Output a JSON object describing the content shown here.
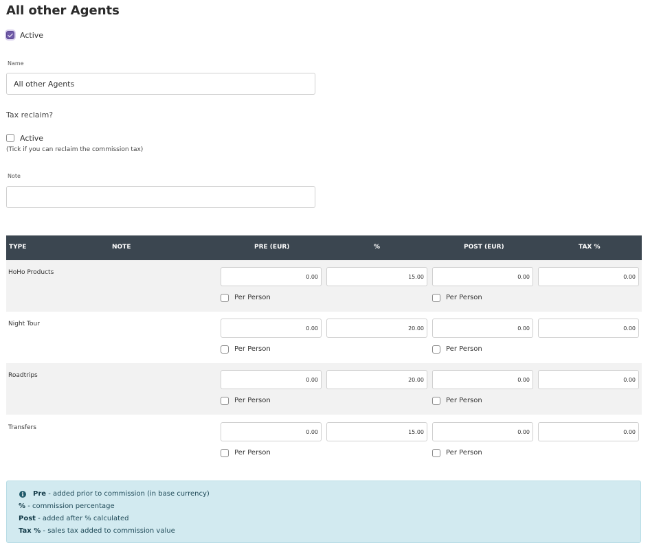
{
  "page_title": "All other Agents",
  "active_checkbox": {
    "label": "Active",
    "checked": true
  },
  "name_field": {
    "label": "Name",
    "value": "All other Agents"
  },
  "tax_reclaim": {
    "heading": "Tax reclaim?",
    "checkbox_label": "Active",
    "checked": false,
    "help": "(Tick if you can reclaim the commission tax)"
  },
  "note_field": {
    "label": "Note",
    "value": ""
  },
  "table": {
    "headers": {
      "type": "TYPE",
      "note": "NOTE",
      "pre": "PRE (EUR)",
      "pct": "%",
      "post": "POST (EUR)",
      "tax": "TAX %"
    },
    "per_person_label": "Per Person",
    "rows": [
      {
        "type": "HoHo Products",
        "pre": "0.00",
        "pct": "15.00",
        "post": "0.00",
        "tax": "0.00"
      },
      {
        "type": "Night Tour",
        "pre": "0.00",
        "pct": "20.00",
        "post": "0.00",
        "tax": "0.00"
      },
      {
        "type": "Roadtrips",
        "pre": "0.00",
        "pct": "20.00",
        "post": "0.00",
        "tax": "0.00"
      },
      {
        "type": "Transfers",
        "pre": "0.00",
        "pct": "15.00",
        "post": "0.00",
        "tax": "0.00"
      }
    ]
  },
  "info": {
    "pre_term": "Pre",
    "pre_desc": " - added prior to commission (in base currency)",
    "pct_term": "%",
    "pct_desc": " - commission percentage",
    "post_term": "Post",
    "post_desc": " - added after % calculated",
    "tax_term": "Tax %",
    "tax_desc": " - sales tax added to commission value"
  },
  "colors": {
    "accent": "#6f5aa8",
    "table_header": "#3b4650",
    "info_bg": "#d2eaf0"
  }
}
